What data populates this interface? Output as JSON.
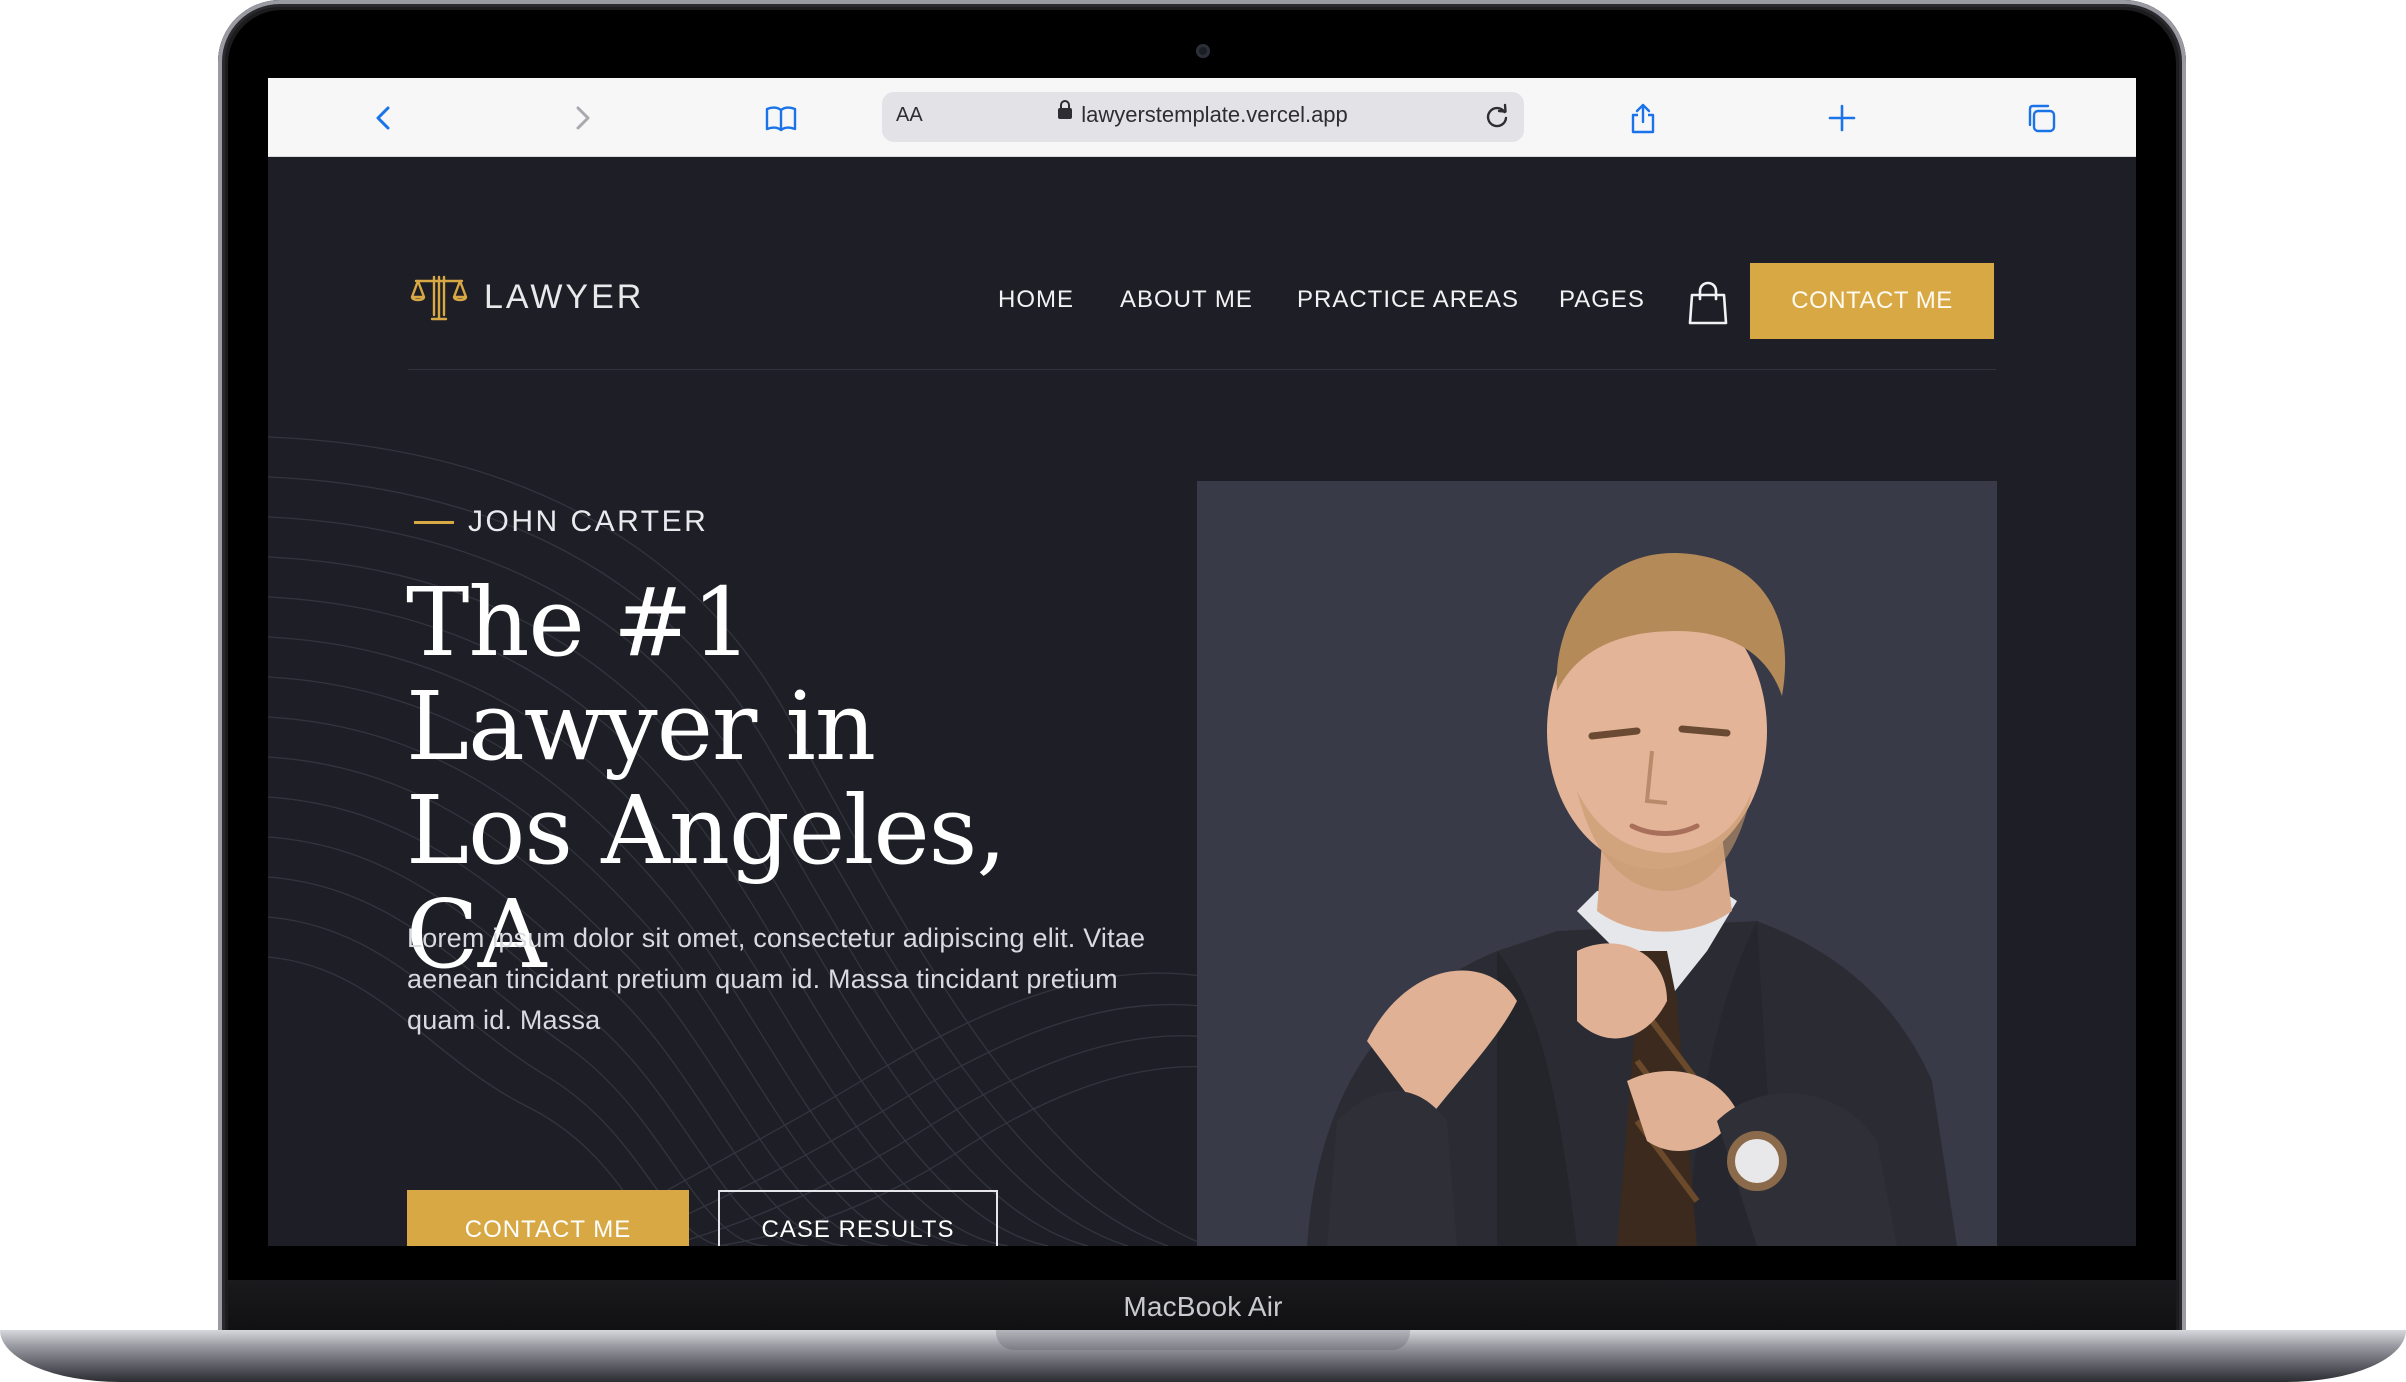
{
  "device": {
    "label": "MacBook Air"
  },
  "browser": {
    "reader_label": "AA",
    "url": "lawyerstemplate.vercel.app",
    "accent_color": "#1a73e8"
  },
  "site": {
    "brand": {
      "name": "LAWYER",
      "icon": "scales-of-justice-icon"
    },
    "nav": {
      "items": [
        {
          "label": "HOME"
        },
        {
          "label": "ABOUT ME"
        },
        {
          "label": "PRACTICE AREAS"
        },
        {
          "label": "PAGES"
        }
      ],
      "cart_icon": "shopping-bag-icon",
      "cta_label": "CONTACT ME"
    },
    "hero": {
      "eyebrow": "JOHN CARTER",
      "headline": "The #1 Lawyer in Los Angeles, CA",
      "body": "Lorem ipsum dolor sit omet, consectetur adipiscing elit. Vitae aenean tincidant pretium quam id. Massa tincidant pretium quam id. Massa",
      "primary_button": "CONTACT ME",
      "secondary_button": "CASE RESULTS"
    },
    "colors": {
      "background": "#1e1f26",
      "accent": "#d8a844",
      "portrait_panel": "#393a47"
    }
  }
}
